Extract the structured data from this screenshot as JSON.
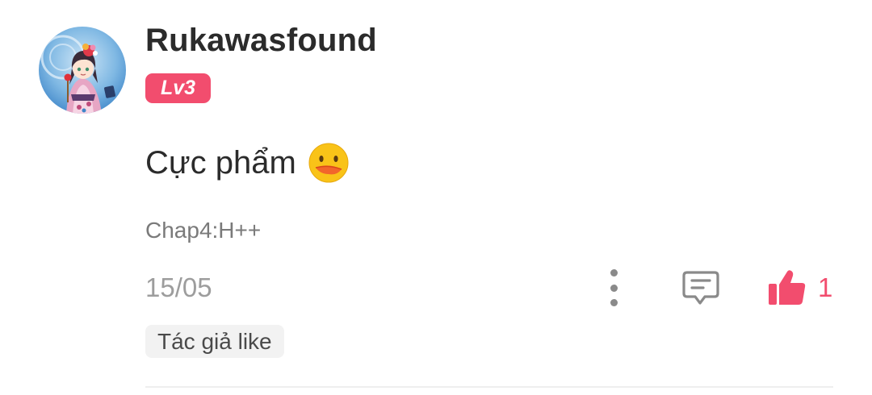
{
  "comment": {
    "username": "Rukawasfound",
    "level_badge": "Lv3",
    "text": "Cực phẩm",
    "emoji_icon": "drooling-face-emoji",
    "chapter": "Chap4:H++",
    "date": "15/05",
    "like_count": "1",
    "author_tag": "Tác giả like"
  },
  "icons": {
    "more": "more-vertical-icon",
    "reply": "comment-bubble-icon",
    "like": "thumbs-up-icon"
  },
  "colors": {
    "accent": "#f24d6e",
    "text_primary": "#2b2b2b",
    "text_secondary": "#7a7a7a",
    "text_muted": "#9d9d9d",
    "tag_background": "#f2f2f2",
    "icon_gray": "#8a8a8a"
  }
}
